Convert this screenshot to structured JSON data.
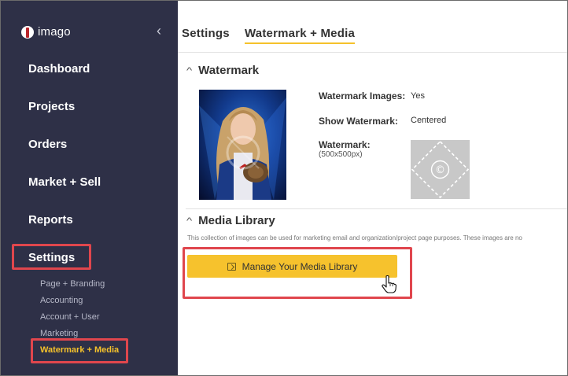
{
  "sidebar": {
    "logo_text": "imago",
    "collapse_glyph": "‹",
    "nav": {
      "dashboard": "Dashboard",
      "projects": "Projects",
      "orders": "Orders",
      "market_sell": "Market + Sell",
      "reports": "Reports",
      "settings": "Settings"
    },
    "settings_sub": {
      "page_branding": "Page + Branding",
      "accounting": "Accounting",
      "account_user": "Account + User",
      "marketing": "Marketing",
      "watermark_media": "Watermark + Media"
    }
  },
  "tabs": {
    "settings": "Settings",
    "watermark_media": "Watermark + Media"
  },
  "watermark": {
    "section_title": "Watermark",
    "images_label": "Watermark Images:",
    "images_value": "Yes",
    "show_label": "Show Watermark:",
    "show_value": "Centered",
    "wm_label": "Watermark:",
    "wm_size": "(500x500px)",
    "symbol": "©"
  },
  "media_library": {
    "section_title": "Media Library",
    "description": "This collection of images can be used for marketing email and organization/project page purposes. These images are no",
    "button_label": "Manage Your Media Library"
  },
  "colors": {
    "sidebar_bg": "#2e3047",
    "accent": "#f5c22b",
    "highlight": "#e0464d"
  }
}
